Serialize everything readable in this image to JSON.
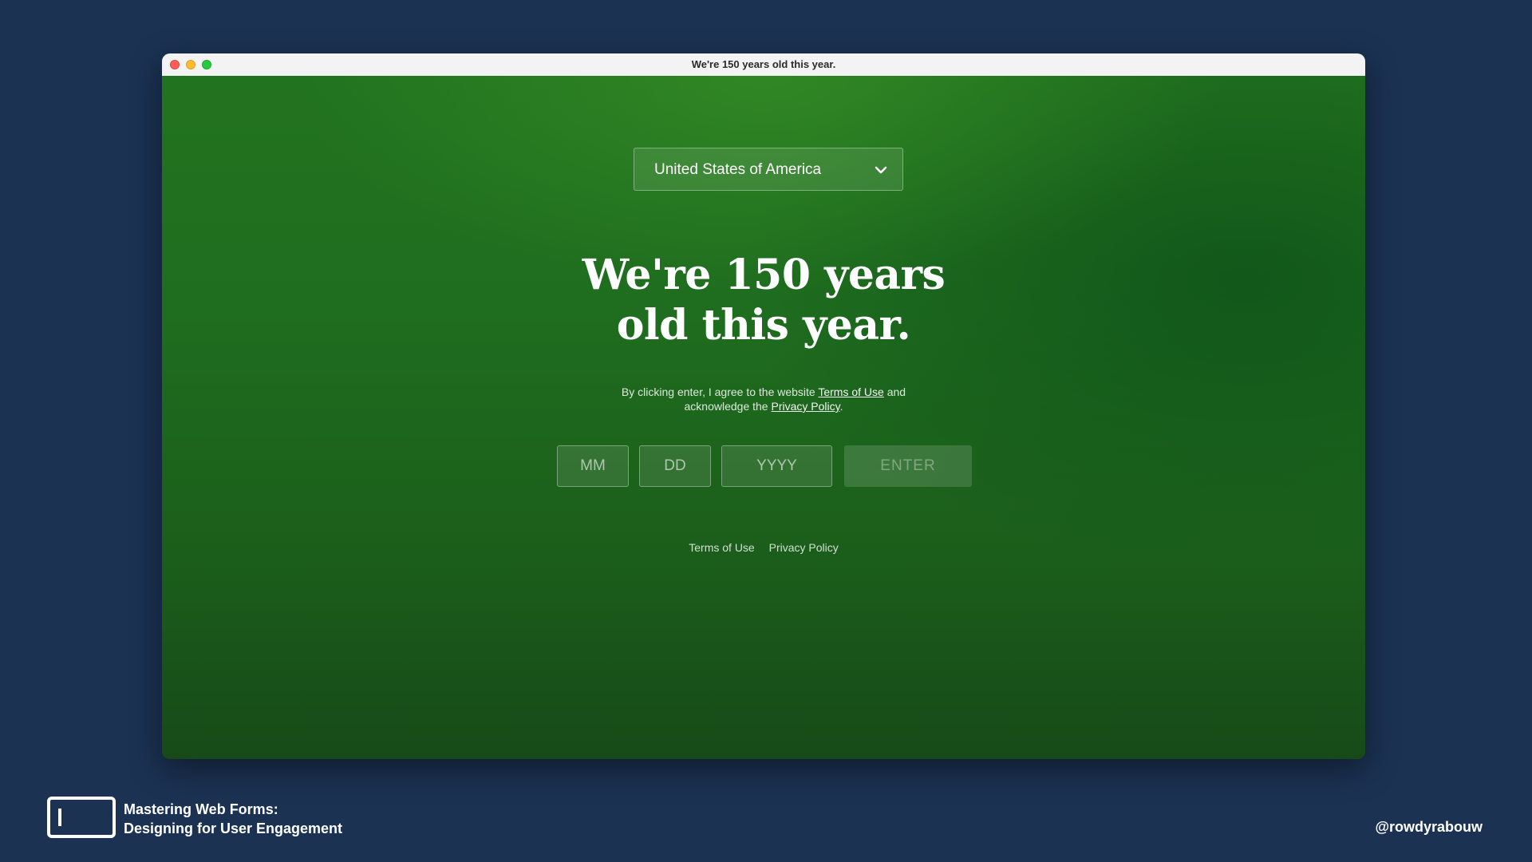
{
  "window": {
    "title": "We're 150 years old this year."
  },
  "country_select": {
    "selected": "United States of America",
    "icon": "chevron-down-icon"
  },
  "hero": {
    "headline_line1": "We're 150 years",
    "headline_line2": "old this year."
  },
  "consent": {
    "prefix": "By clicking enter, I agree to the website ",
    "terms_link": "Terms of Use",
    "middle": " and",
    "line2_prefix": "acknowledge the ",
    "privacy_link": "Privacy Policy",
    "suffix": "."
  },
  "birthdate": {
    "month_placeholder": "MM",
    "day_placeholder": "DD",
    "year_placeholder": "YYYY",
    "enter_label": "ENTER"
  },
  "footer": {
    "terms": "Terms of Use",
    "privacy": "Privacy Policy"
  },
  "slide": {
    "title_line1": "Mastering Web Forms:",
    "title_line2": "Designing for User Engagement",
    "handle": "@rowdyrabouw"
  },
  "colors": {
    "slide_background": "#1b3253",
    "page_green": "#1f6d1f",
    "traffic_close": "#ff5f57",
    "traffic_minimize": "#febc2e",
    "traffic_maximize": "#28c840"
  }
}
